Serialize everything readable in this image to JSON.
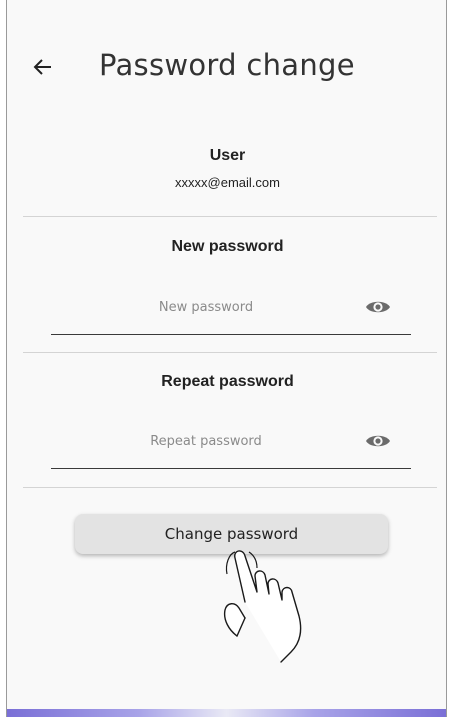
{
  "header": {
    "back_icon": "arrow-left-icon",
    "title": "Password change"
  },
  "user_section": {
    "label": "User",
    "email": "xxxxx@email.com"
  },
  "new_password": {
    "label": "New password",
    "placeholder": "New password",
    "value": "",
    "visibility_icon": "eye-icon"
  },
  "repeat_password": {
    "label": "Repeat password",
    "placeholder": "Repeat password",
    "value": "",
    "visibility_icon": "eye-icon"
  },
  "actions": {
    "change_password_label": "Change password"
  },
  "overlay": {
    "pointer_icon": "tap-hand-icon"
  },
  "colors": {
    "background": "#f9f9f9",
    "text": "#222222",
    "button": "#e3e3e3",
    "icon": "#6b6b6b",
    "accent_bottom": "#7a6fd6"
  }
}
